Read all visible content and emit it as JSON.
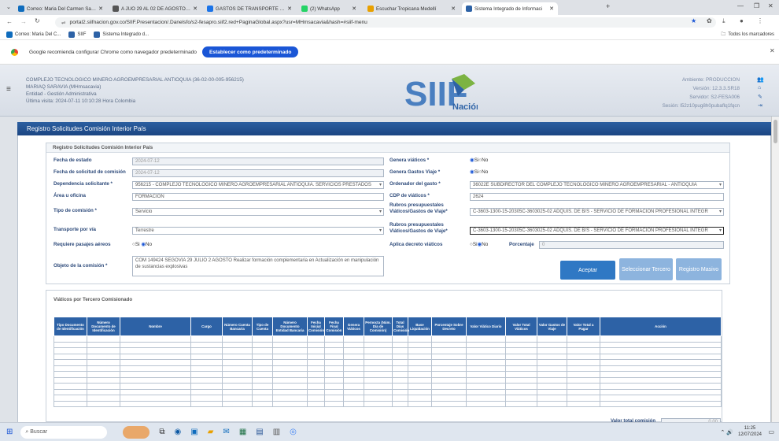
{
  "browser": {
    "tabs": [
      {
        "label": "Correo: Maria Del Carmen Sar...",
        "color": "#0f6cbd"
      },
      {
        "label": "A JUO 29 AL 02 DE AGOSTO.pdf",
        "color": "#555"
      },
      {
        "label": "GASTOS DE TRANSPORTE - Dr...",
        "color": "#1a73e8"
      },
      {
        "label": "(2) WhatsApp",
        "color": "#25d366"
      },
      {
        "label": "Escuchar Tropicana Medellí",
        "color": "#e8a000"
      },
      {
        "label": "Sistema Integrado de Informaci",
        "color": "#2d62a6"
      }
    ],
    "url": "portal2.siifnacion.gov.co/SIIF.Presentacion/.Danelsfo/s2-fesapro.siif2.red+PaginaGlobal.aspx?usr=MHmsacavia&hash=#siif-menu",
    "bookmarks": [
      "Correo: Maria Del C...",
      "SIIF",
      "Sistema Integrado d..."
    ],
    "bookmarks_right": "Todos los marcadores",
    "info_text": "Google recomienda configurar Chrome como navegador predeterminado",
    "info_button": "Establecer como predeterminado"
  },
  "header": {
    "entity": "COMPLEJO TECNOLOGICO MINERO AGROEMPRESARIAL ANTIOQUIA (36-02-00-005-956215)",
    "user": "MARIAQ SARAVIA (MHmsacavia)",
    "entity_type": "Entidad - Gestión Administrativa",
    "last_visit": "Última visita: 2024-07-11 10:10:28 Hora Colombia",
    "ambiente": "Ambiente: PRODUCCION",
    "version": "Versión: 12.3.3.SR18",
    "servidor": "Servidor: S2-FESA006",
    "sesion": "Sesión: l52z10pug8h0pubaflq1fqcn",
    "logo_main": "SIIF",
    "logo_sub": "Nación"
  },
  "page_title": "Registro Solicitudes Comisión Interior País",
  "form": {
    "title": "Registro Solicitudes Comisión Interior País",
    "fecha_estado_label": "Fecha de estado",
    "fecha_estado": "2024-07-12",
    "fecha_solicitud_label": "Fecha de solicitud de comisión",
    "fecha_solicitud": "2024-07-12",
    "dependencia_label": "Dependencia solicitante *",
    "dependencia": "956215 - COMPLEJO TECNOLOGICO MINERO AGROEMPRESARIAL ANTIOQUIA. SERVICIOS PRESTADOS",
    "area_label": "Área u oficina",
    "area": "FORMACION",
    "tipo_label": "Tipo de comisión *",
    "tipo": "Servicio",
    "transporte_label": "Transporte por vía",
    "transporte": "Terrestre",
    "pasajes_label": "Requiere pasajes aéreos",
    "pasajes_si": "Si",
    "pasajes_no": "No",
    "objeto_label": "Objeto de la comisión *",
    "objeto": "COM 149424 SEGOVIA 29 JULIO 2 AGOSTO Realizar formación complementaria en Actualización en manipulación de sustancias explosivas",
    "genera_viaticos_label": "Genera viáticos *",
    "genera_gastos_label": "Genera Gastos Viaje *",
    "si": "Si",
    "no": "No",
    "ordenador_label": "Ordenador del gasto *",
    "ordenador": "36022E SUBDIRECTOR DEL COMPLEJO TECNOLOGICO MINERO AGROEMPRESARIAL - ANTIOQUIA",
    "cdp_label": "CDP de viáticos *",
    "cdp": "2624",
    "rubros1_label": "Rubros presupuestales Viáticos/Gastos de Viaje*",
    "rubros1": "C-3603-1300-15-20305C-3603025-02 ADQUIS. DE B/S - SERVICIO DE FORMACIÓN PROFESIONAL INTEGR",
    "rubros2_label": "Rubros presupuestales Viáticos/Gastos de Viaje*",
    "rubros2": "C-3603-1300-15-20305C-3603025-02 ADQUIS. DE B/S - SERVICIO DE FORMACIÓN PROFESIONAL INTEGR",
    "decreto_label": "Aplica decreto viáticos",
    "porcentaje_label": "Porcentaje",
    "porcentaje": "0",
    "aceptar": "Aceptar",
    "seleccionar": "Seleccionar Tercero",
    "registro": "Registro Masivo"
  },
  "viaticos": {
    "title": "Viáticos por Tercero Comisionado",
    "columns": [
      "Tipo Documento de Identificación",
      "Número Documento de Identificación",
      "Nombre",
      "Cargo",
      "Número Cuenta Bancaria",
      "Tipo de Cuenta",
      "Número Documento Entidad Bancaria",
      "Fecha Inicial Comisión",
      "Fecha Final Comisión",
      "Genera Viáticos",
      "Pernocta (Núm. Día de Comisión)",
      "Total Días Comisión",
      "Base Liquidación",
      "Porcentaje Sobre Decreto",
      "Valor Viático Diario",
      "Valor Total Viáticos",
      "Valor Gastos de Viaje",
      "Valor Total a Pagar",
      "Acción"
    ],
    "total_label": "Valor total comisión",
    "total": "0.00"
  },
  "taskbar": {
    "search": "Buscar",
    "time": "11:25",
    "date": "12/07/2024"
  }
}
